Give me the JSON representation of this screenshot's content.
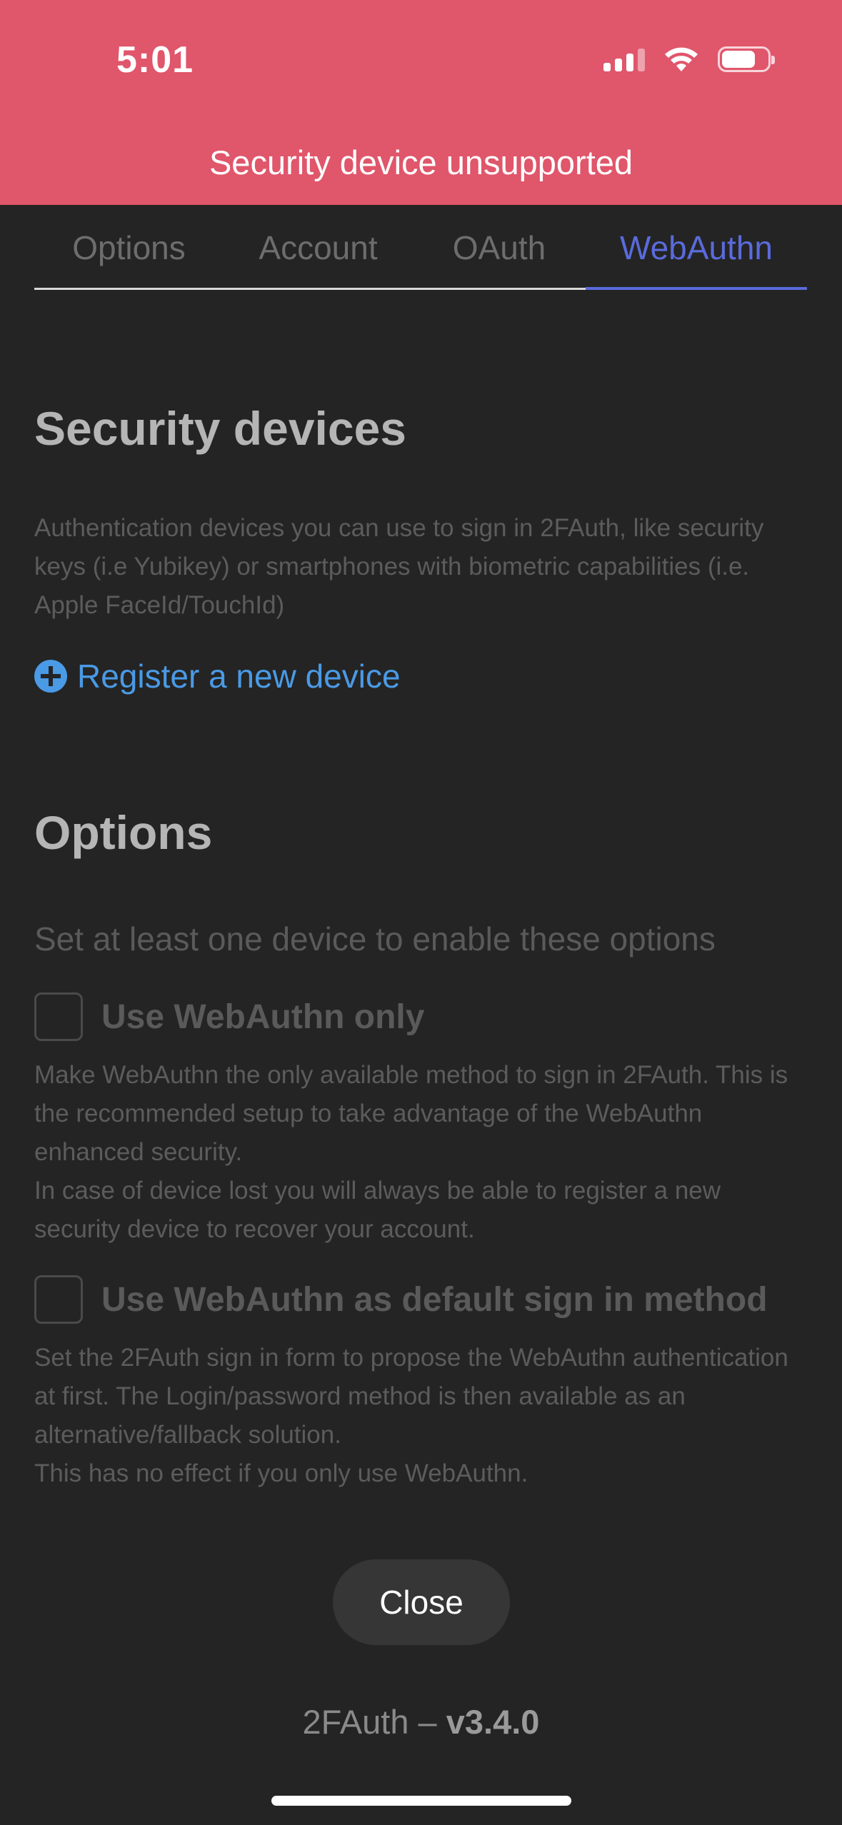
{
  "status_bar": {
    "time": "5:01"
  },
  "banner": {
    "message": "Security device unsupported",
    "color": "#e0566b"
  },
  "tabs": [
    {
      "label": "Options",
      "active": false
    },
    {
      "label": "Account",
      "active": false
    },
    {
      "label": "OAuth",
      "active": false
    },
    {
      "label": "WebAuthn",
      "active": true
    }
  ],
  "security_devices": {
    "title": "Security devices",
    "help": "Authentication devices you can use to sign in 2FAuth, like security keys (i.e Yubikey) or smartphones with biometric capabilities (i.e. Apple FaceId/TouchId)",
    "register_label": "Register a new device"
  },
  "options": {
    "title": "Options",
    "note": "Set at least one device to enable these options",
    "use_webauthn_only": {
      "label": "Use WebAuthn only",
      "checked": false,
      "help_line1": "Make WebAuthn the only available method to sign in 2FAuth. This is the recommended setup to take advantage of the WebAuthn enhanced security.",
      "help_line2": "In case of device lost you will always be able to register a new security device to recover your account."
    },
    "use_webauthn_default": {
      "label": "Use WebAuthn as default sign in method",
      "checked": false,
      "help_line1": "Set the 2FAuth sign in form to propose the WebAuthn authentication at first. The Login/password method is then available as an alternative/fallback solution.",
      "help_line2": "This has no effect if you only use WebAuthn."
    }
  },
  "close_label": "Close",
  "footer": {
    "app_name": "2FAuth –",
    "version": "v3.4.0"
  },
  "colors": {
    "accent": "#5a6bdb",
    "link": "#4a9ae6",
    "background": "#242424"
  }
}
